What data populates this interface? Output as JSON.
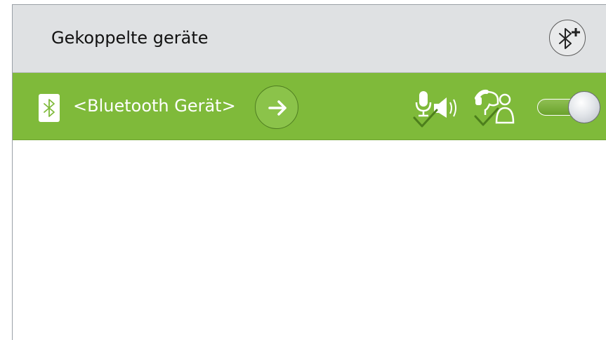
{
  "header": {
    "title": "Gekoppelte geräte",
    "add_button_icon": "bluetooth-add-icon"
  },
  "device_row": {
    "name": "<Bluetooth Gerät>",
    "background_color": "#7fba3a",
    "leading_icon": "bluetooth-icon",
    "details_icon": "arrow-right-icon",
    "profiles": [
      {
        "icon": "audio-profile-icon",
        "status": "connected"
      },
      {
        "icon": "handsfree-profile-icon",
        "status": "connected"
      }
    ],
    "toggle": {
      "state": "on"
    }
  }
}
